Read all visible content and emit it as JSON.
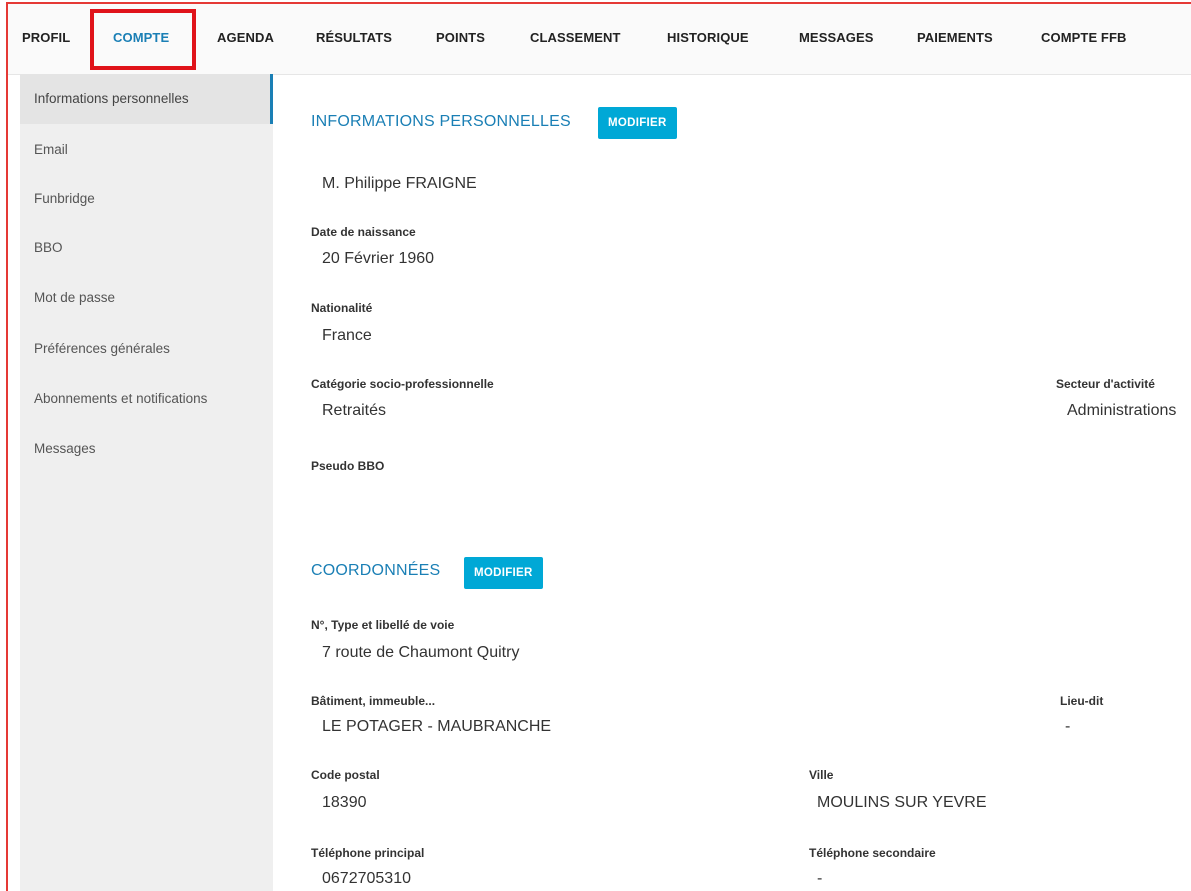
{
  "nav": {
    "items": [
      {
        "label": "PROFIL",
        "active": false
      },
      {
        "label": "COMPTE",
        "active": true
      },
      {
        "label": "AGENDA",
        "active": false
      },
      {
        "label": "RÉSULTATS",
        "active": false
      },
      {
        "label": "POINTS",
        "active": false
      },
      {
        "label": "CLASSEMENT",
        "active": false
      },
      {
        "label": "HISTORIQUE",
        "active": false
      },
      {
        "label": "MESSAGES",
        "active": false
      },
      {
        "label": "PAIEMENTS",
        "active": false
      },
      {
        "label": "COMPTE FFB",
        "active": false
      }
    ]
  },
  "sidebar": {
    "items": [
      {
        "label": "Informations personnelles",
        "active": true
      },
      {
        "label": "Email",
        "active": false
      },
      {
        "label": "Funbridge",
        "active": false
      },
      {
        "label": "BBO",
        "active": false
      },
      {
        "label": "Mot de passe",
        "active": false
      },
      {
        "label": "Préférences générales",
        "active": false
      },
      {
        "label": "Abonnements et notifications",
        "active": false
      },
      {
        "label": "Messages",
        "active": false
      }
    ]
  },
  "personal": {
    "title": "INFORMATIONS PERSONNELLES",
    "edit_label": "MODIFIER",
    "name": "M. Philippe FRAIGNE",
    "birth_label": "Date de naissance",
    "birth_value": "20 Février 1960",
    "nationality_label": "Nationalité",
    "nationality_value": "France",
    "csp_label": "Catégorie socio-professionnelle",
    "csp_value": "Retraités",
    "sector_label": "Secteur d'activité",
    "sector_value": "Administrations",
    "bbo_label": "Pseudo BBO"
  },
  "contact": {
    "title": "COORDONNÉES",
    "edit_label": "MODIFIER",
    "street_label": "N°, Type et libellé de voie",
    "street_value": "7 route de Chaumont Quitry",
    "building_label": "Bâtiment, immeuble...",
    "building_value": "LE POTAGER - MAUBRANCHE",
    "lieu_label": "Lieu-dit",
    "lieu_value": "-",
    "postal_label": "Code postal",
    "postal_value": "18390",
    "city_label": "Ville",
    "city_value": "MOULINS SUR YEVRE",
    "phone1_label": "Téléphone principal",
    "phone1_value": "0672705310",
    "phone2_label": "Téléphone secondaire",
    "phone2_value": "-"
  }
}
